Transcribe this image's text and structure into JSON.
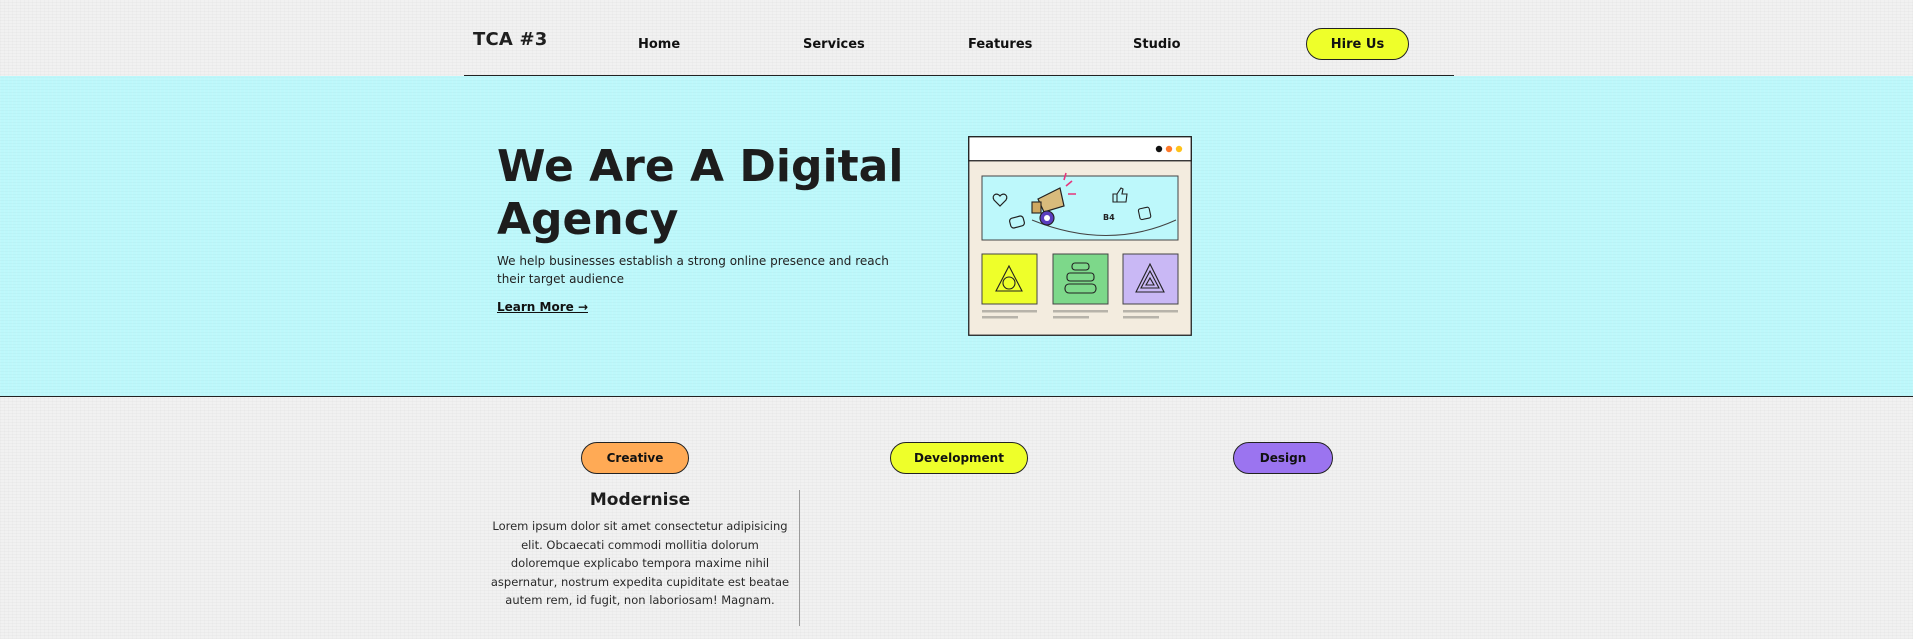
{
  "nav": {
    "logo": "TCA #3",
    "links": [
      "Home",
      "Services",
      "Features",
      "Studio"
    ],
    "cta": "Hire Us"
  },
  "hero": {
    "title": "We Are A Digital Agency",
    "subtitle": "We help businesses establish a strong online presence and reach their target audience",
    "link": "Learn More →",
    "illustration_badge": "B4"
  },
  "tags": [
    "Creative",
    "Development",
    "Design"
  ],
  "card": {
    "title": "Modernise",
    "text": "Lorem ipsum dolor sit amet consectetur adipisicing elit. Obcaecati commodi mollitia dolorum doloremque explicabo tempora maxime nihil aspernatur, nostrum expedita cupiditate est beatae autem rem, id fugit, non laboriosam! Magnam."
  },
  "colors": {
    "hero_bg": "#bdf8fb",
    "cta_yellow": "#eeff2a",
    "creative_orange": "#ffaa55",
    "design_purple": "#9b74f0",
    "tile_green": "#7dd88a",
    "tile_lavender": "#c9b8f5"
  }
}
